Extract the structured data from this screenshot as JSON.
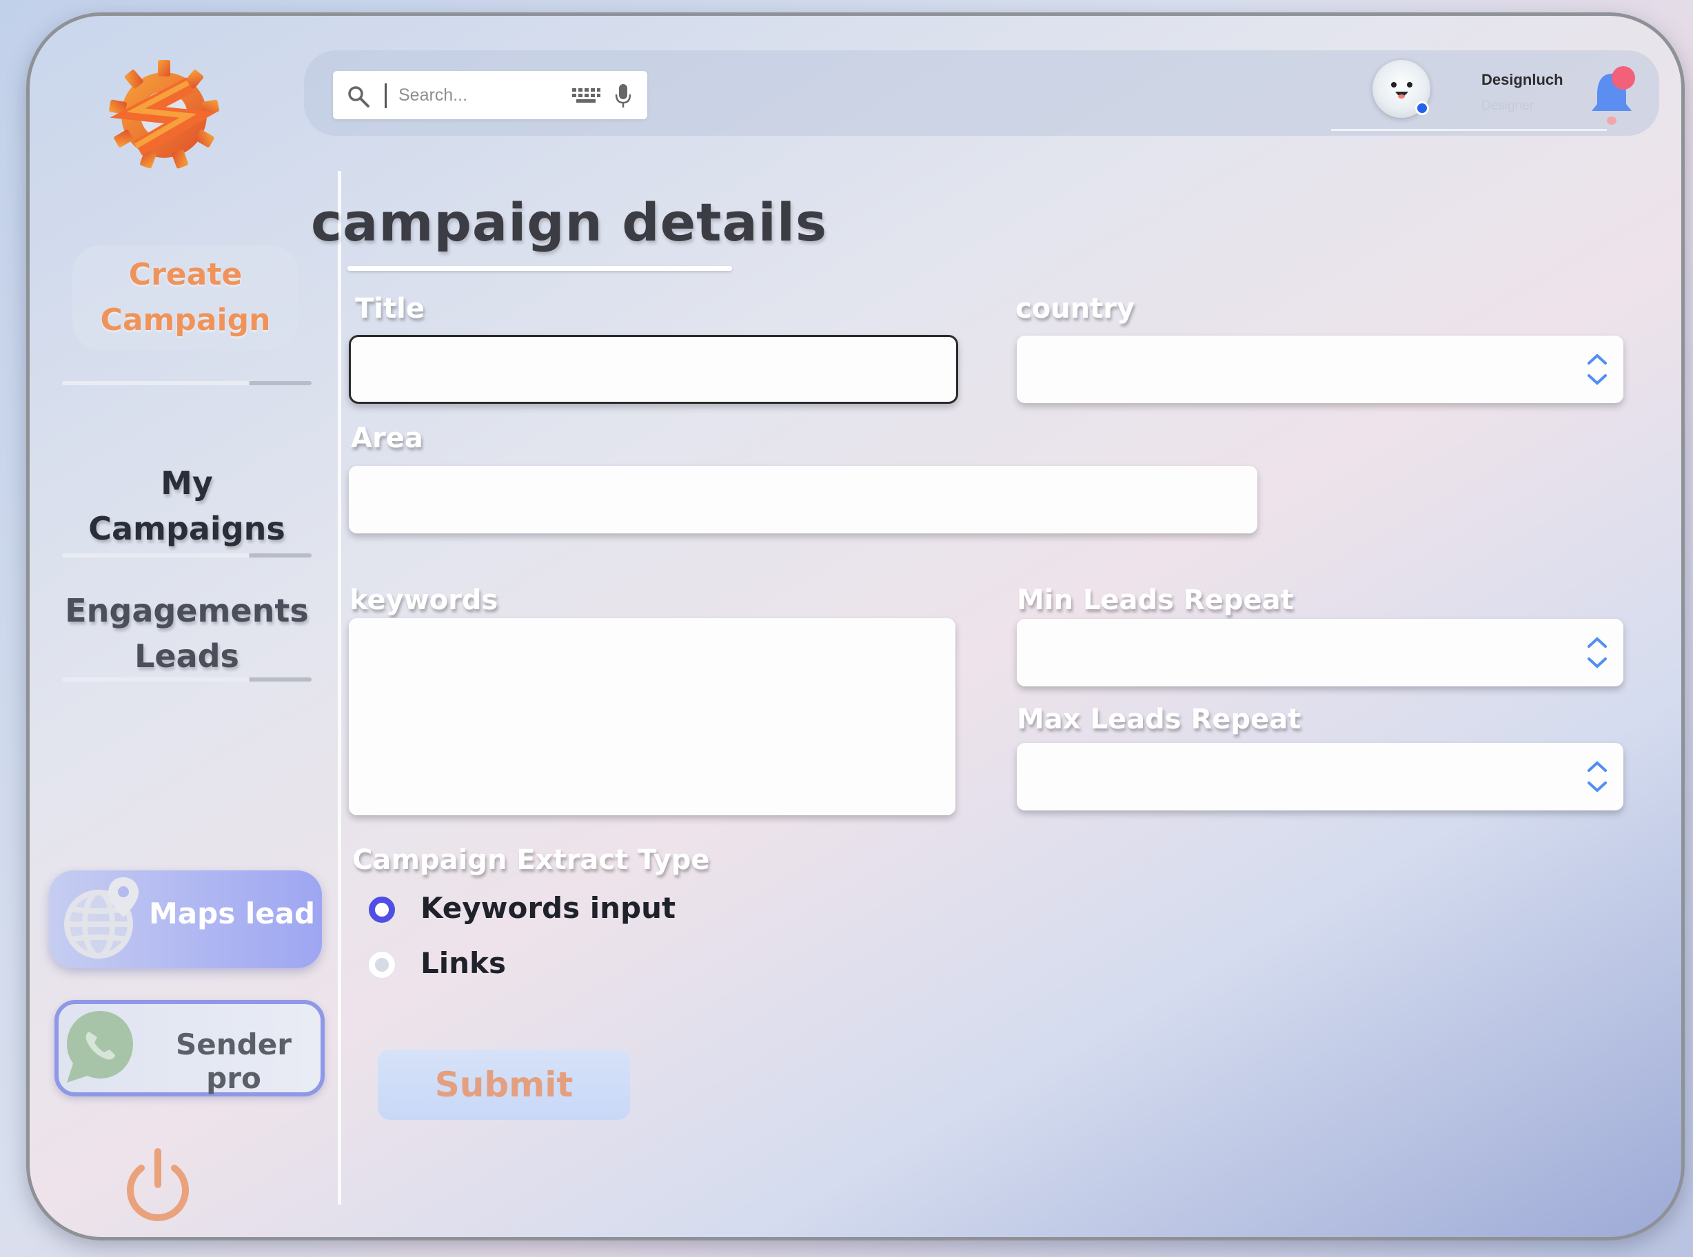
{
  "search": {
    "placeholder": "Search..."
  },
  "user": {
    "name": "Designluch",
    "role": "Designer"
  },
  "sidebar": {
    "create_label_1": "Create",
    "create_label_2": "Campaign",
    "my_campaigns": "My Campaigns",
    "engagements_1": "Engagements",
    "engagements_2": "Leads",
    "maps_lead": "Maps lead",
    "sender_pro": "Sender pro"
  },
  "page": {
    "title": "campaign details"
  },
  "form": {
    "title_label": "Title",
    "title_value": "",
    "country_label": "country",
    "area_label": "Area",
    "keywords_label": "keywords",
    "min_leads_label": "Min Leads Repeat",
    "max_leads_label": "Max Leads Repeat",
    "extract_type_label": "Campaign Extract Type",
    "options": [
      {
        "label": "Keywords input",
        "selected": true
      },
      {
        "label": "Links",
        "selected": false
      }
    ],
    "submit_label": "Submit"
  },
  "colors": {
    "accent_orange": "#f0935a",
    "radio_selected": "#4f4fe3",
    "maps_gradient_end": "#9ea6f2",
    "sender_border": "#8f98e6"
  },
  "icons": [
    "logo-gear-icon",
    "search-icon",
    "keyboard-icon",
    "mic-icon",
    "avatar",
    "bell-icon",
    "globe-pin-icon",
    "whatsapp-icon",
    "power-icon",
    "spinner-icon"
  ]
}
